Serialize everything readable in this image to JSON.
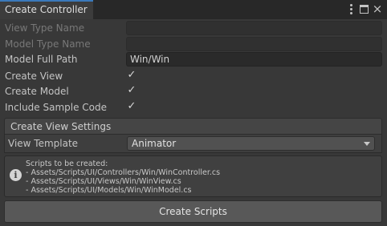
{
  "window": {
    "tab_title": "Create Controller"
  },
  "form": {
    "view_type_name": {
      "label": "View Type Name",
      "value": ""
    },
    "model_type_name": {
      "label": "Model Type Name",
      "value": ""
    },
    "model_full_path": {
      "label": "Model Full Path",
      "value": "Win/Win"
    },
    "create_view": {
      "label": "Create View",
      "checked": true
    },
    "create_model": {
      "label": "Create Model",
      "checked": true
    },
    "include_sample_code": {
      "label": "Include Sample Code",
      "checked": true
    }
  },
  "view_settings": {
    "header": "Create View Settings",
    "view_template": {
      "label": "View Template",
      "selected": "Animator"
    }
  },
  "help": {
    "icon": "info-icon",
    "text": "Scripts to be created:\n- Assets/Scripts/UI/Controllers/Win/WinController.cs\n- Assets/Scripts/UI/Views/Win/WinView.cs\n- Assets/Scripts/UI/Models/Win/WinModel.cs"
  },
  "actions": {
    "create_scripts": "Create Scripts"
  },
  "icons": {
    "check": "✓",
    "info": "i",
    "close": "×"
  },
  "colors": {
    "tab_accent": "#3a79bb",
    "background": "#383838",
    "button": "#585858"
  }
}
